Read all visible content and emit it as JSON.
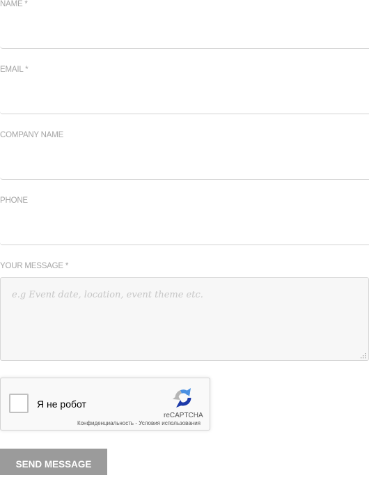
{
  "form": {
    "name": {
      "label": "NAME *",
      "value": ""
    },
    "email": {
      "label": "EMAIL *",
      "value": ""
    },
    "company": {
      "label": "COMPANY NAME",
      "value": ""
    },
    "phone": {
      "label": "PHONE",
      "value": ""
    },
    "message": {
      "label": "YOUR MESSAGE *",
      "placeholder": "e.g Event date, location, event theme etc.",
      "value": ""
    }
  },
  "recaptcha": {
    "checkbox_label": "Я не робот",
    "brand": "reCAPTCHA",
    "privacy_link": "Конфиденциальность",
    "separator": " - ",
    "terms_link": "Условия использования",
    "checked": false,
    "icon": "recaptcha-logo-icon",
    "colors": {
      "blue": "#1c3aa9",
      "light_blue": "#4a90e2",
      "gray": "#b5b5b5"
    }
  },
  "submit": {
    "label": "SEND MESSAGE",
    "background": "#9b9b9b"
  }
}
